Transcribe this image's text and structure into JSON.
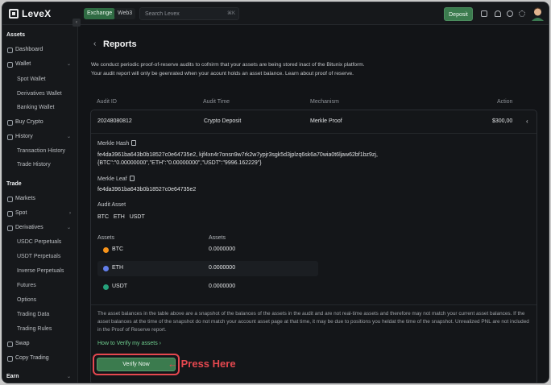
{
  "header": {
    "logo": "LeveX",
    "tabs": [
      "Exchange",
      "Web3"
    ],
    "search_placeholder": "Search Levex",
    "search_shortcut": "⌘K",
    "deposit_label": "Deposit"
  },
  "sidebar": {
    "items": [
      {
        "label": "Assets",
        "kind": "head"
      },
      {
        "label": "Dashboard",
        "kind": "item"
      },
      {
        "label": "Wallet",
        "kind": "item",
        "chevron": "⌄"
      },
      {
        "label": "Spot Wallet",
        "kind": "sub"
      },
      {
        "label": "Derivatives Wallet",
        "kind": "sub"
      },
      {
        "label": "Banking Wallet",
        "kind": "sub"
      },
      {
        "label": "Buy Crypto",
        "kind": "item"
      },
      {
        "label": "History",
        "kind": "item",
        "chevron": "⌄"
      },
      {
        "label": "Transaction History",
        "kind": "sub"
      },
      {
        "label": "Trade History",
        "kind": "sub"
      },
      {
        "label": "Trade",
        "kind": "head"
      },
      {
        "label": "Markets",
        "kind": "item"
      },
      {
        "label": "Spot",
        "kind": "item",
        "chevron": "›"
      },
      {
        "label": "Derivatives",
        "kind": "item",
        "chevron": "⌄"
      },
      {
        "label": "USDC Perpetuals",
        "kind": "sub"
      },
      {
        "label": "USDT Perpetuals",
        "kind": "sub"
      },
      {
        "label": "Inverse Perpetuals",
        "kind": "sub"
      },
      {
        "label": "Futures",
        "kind": "sub"
      },
      {
        "label": "Options",
        "kind": "sub"
      },
      {
        "label": "Trading Data",
        "kind": "sub"
      },
      {
        "label": "Trading Rules",
        "kind": "sub"
      },
      {
        "label": "Swap",
        "kind": "item"
      },
      {
        "label": "Copy Trading",
        "kind": "item"
      },
      {
        "label": "Earn",
        "kind": "head",
        "chevron": "⌄"
      }
    ]
  },
  "page": {
    "title": "Reports",
    "intro_line1": "We conduct periodic proof-of-reserve audits to cofnirm that your assets are being stored inact of the Bitunix platform.",
    "intro_line2": "Your audit report will only be geenrated when your acount holds an asset balance. Learn about proof of reserve."
  },
  "table": {
    "columns": [
      "Audit ID",
      "Audit Time",
      "Mechanism",
      "Action"
    ],
    "row": {
      "audit_id": "20248080812",
      "audit_time": "Crypto Deposit",
      "mechanism": "Merkle Proof",
      "action": "$300,00"
    }
  },
  "details": {
    "merkle_hash_label": "Merkle Hash",
    "merkle_hash_line1": "fe4da3961ba643b0b18527c0e64735e2, kjf4xn4r7onsn9w7rk2w7ypjr3sgk5d3jplzq6sk6a70wia0t6ljaw62bf1bz9zj,",
    "merkle_hash_line2": "{BTC\":\"0.00000000\",\"ETH\":\"0.00000000\",\"USDT\":\"9996.162229\"}",
    "merkle_leaf_label": "Merkle Leaf",
    "merkle_leaf_value": "fe4da3961ba643b0b18527c0e64735e2",
    "audit_asset_label": "Audit Asset",
    "audit_assets": [
      "BTC",
      "ETH",
      "USDT"
    ],
    "assets_headers": [
      "Assets",
      "Assets"
    ],
    "assets": [
      {
        "name": "BTC",
        "value": "0.0000000",
        "color": "#f7931a"
      },
      {
        "name": "ETH",
        "value": "0.0000000",
        "color": "#627eea"
      },
      {
        "name": "USDT",
        "value": "0.0000000",
        "color": "#26a17b"
      }
    ],
    "note": "The asset balances in the table above are a snapshot of the balances of the assets in the audit and are not real-time assets and therefore may not match your current asset balances. If the asset balances at the time of the snapshot do not match your account asset page at that time, it may be due to positions you heldat the time of the snapshot. Unrealized PNL are not included in the Proof of Reserve report.",
    "howto": "How to Verify my assets  ›"
  },
  "cta": {
    "verify_label": "Verify Now",
    "annotation": "←  Press Here"
  }
}
